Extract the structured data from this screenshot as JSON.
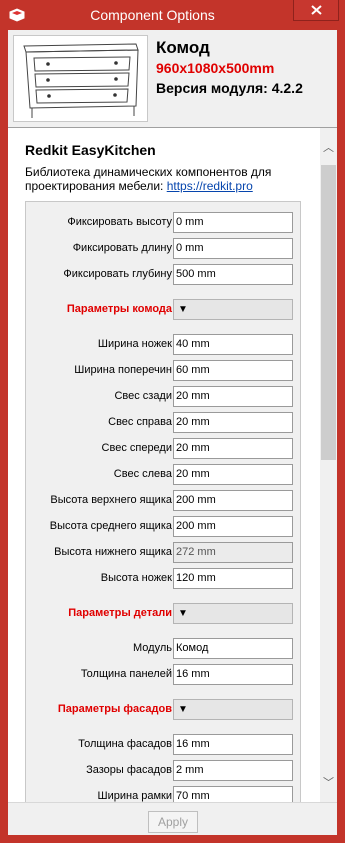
{
  "window": {
    "title": "Component Options"
  },
  "header": {
    "name": "Комод",
    "dimensions": "960x1080x500mm",
    "version": "Версия модуля: 4.2.2"
  },
  "brand": {
    "title": "Redkit EasyKitchen",
    "description": "Библиотека динамических компонентов для проектирования мебели: ",
    "link": "https://redkit.pro"
  },
  "fields": [
    {
      "label": "Фиксировать высоту",
      "value": "0 mm",
      "type": "input"
    },
    {
      "label": "Фиксировать длину",
      "value": "0 mm",
      "type": "input"
    },
    {
      "label": "Фиксировать глубину",
      "value": "500 mm",
      "type": "input"
    },
    {
      "label": "Параметры комода",
      "value": "▼",
      "type": "section"
    },
    {
      "label": "Ширина ножек",
      "value": "40 mm",
      "type": "input"
    },
    {
      "label": "Ширина поперечин",
      "value": "60 mm",
      "type": "input"
    },
    {
      "label": "Свес сзади",
      "value": "20 mm",
      "type": "input"
    },
    {
      "label": "Свес справа",
      "value": "20 mm",
      "type": "input"
    },
    {
      "label": "Свес спереди",
      "value": "20 mm",
      "type": "input"
    },
    {
      "label": "Свес слева",
      "value": "20 mm",
      "type": "input"
    },
    {
      "label": "Высота верхнего ящика",
      "value": "200 mm",
      "type": "input"
    },
    {
      "label": "Высота среднего ящика",
      "value": "200 mm",
      "type": "input"
    },
    {
      "label": "Высота нижнего ящика",
      "value": "272 mm",
      "type": "readonly"
    },
    {
      "label": "Высота ножек",
      "value": "120 mm",
      "type": "input"
    },
    {
      "label": "Параметры детали",
      "value": "▼",
      "type": "section"
    },
    {
      "label": "Модуль",
      "value": "Комод",
      "type": "input"
    },
    {
      "label": "Толщина панелей",
      "value": "16 mm",
      "type": "input"
    },
    {
      "label": "Параметры фасадов",
      "value": "▼",
      "type": "section"
    },
    {
      "label": "Толщина фасадов",
      "value": "16 mm",
      "type": "input"
    },
    {
      "label": "Зазоры фасадов",
      "value": "2 mm",
      "type": "input"
    },
    {
      "label": "Ширина рамки",
      "value": "70 mm",
      "type": "input"
    }
  ],
  "footer": {
    "apply_label": "Apply"
  },
  "colors": {
    "title_bar": "#c3342a",
    "accent_red": "#e00000",
    "link": "#0645ad"
  }
}
